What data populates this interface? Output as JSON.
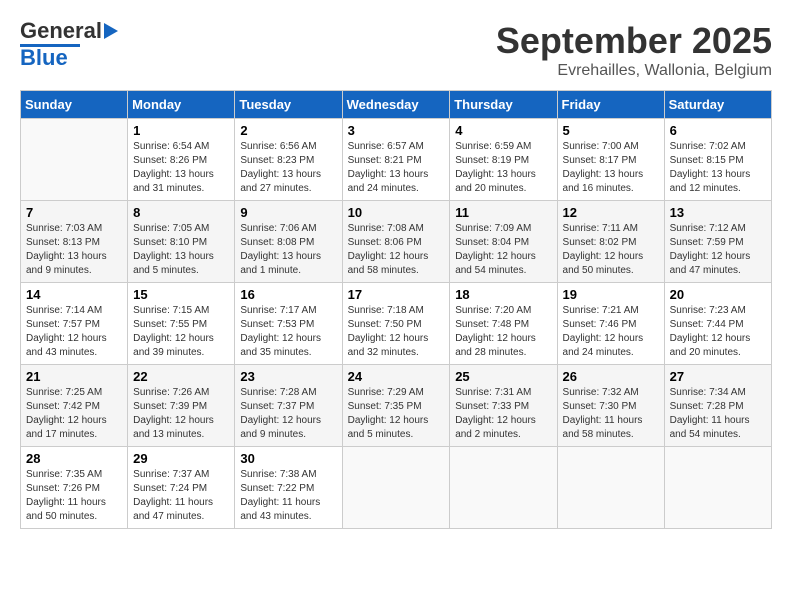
{
  "header": {
    "logo_top": "General",
    "logo_bottom": "Blue",
    "month": "September 2025",
    "location": "Evrehailles, Wallonia, Belgium"
  },
  "columns": [
    "Sunday",
    "Monday",
    "Tuesday",
    "Wednesday",
    "Thursday",
    "Friday",
    "Saturday"
  ],
  "weeks": [
    [
      {
        "day": "",
        "info": ""
      },
      {
        "day": "1",
        "info": "Sunrise: 6:54 AM\nSunset: 8:26 PM\nDaylight: 13 hours\nand 31 minutes."
      },
      {
        "day": "2",
        "info": "Sunrise: 6:56 AM\nSunset: 8:23 PM\nDaylight: 13 hours\nand 27 minutes."
      },
      {
        "day": "3",
        "info": "Sunrise: 6:57 AM\nSunset: 8:21 PM\nDaylight: 13 hours\nand 24 minutes."
      },
      {
        "day": "4",
        "info": "Sunrise: 6:59 AM\nSunset: 8:19 PM\nDaylight: 13 hours\nand 20 minutes."
      },
      {
        "day": "5",
        "info": "Sunrise: 7:00 AM\nSunset: 8:17 PM\nDaylight: 13 hours\nand 16 minutes."
      },
      {
        "day": "6",
        "info": "Sunrise: 7:02 AM\nSunset: 8:15 PM\nDaylight: 13 hours\nand 12 minutes."
      }
    ],
    [
      {
        "day": "7",
        "info": "Sunrise: 7:03 AM\nSunset: 8:13 PM\nDaylight: 13 hours\nand 9 minutes."
      },
      {
        "day": "8",
        "info": "Sunrise: 7:05 AM\nSunset: 8:10 PM\nDaylight: 13 hours\nand 5 minutes."
      },
      {
        "day": "9",
        "info": "Sunrise: 7:06 AM\nSunset: 8:08 PM\nDaylight: 13 hours\nand 1 minute."
      },
      {
        "day": "10",
        "info": "Sunrise: 7:08 AM\nSunset: 8:06 PM\nDaylight: 12 hours\nand 58 minutes."
      },
      {
        "day": "11",
        "info": "Sunrise: 7:09 AM\nSunset: 8:04 PM\nDaylight: 12 hours\nand 54 minutes."
      },
      {
        "day": "12",
        "info": "Sunrise: 7:11 AM\nSunset: 8:02 PM\nDaylight: 12 hours\nand 50 minutes."
      },
      {
        "day": "13",
        "info": "Sunrise: 7:12 AM\nSunset: 7:59 PM\nDaylight: 12 hours\nand 47 minutes."
      }
    ],
    [
      {
        "day": "14",
        "info": "Sunrise: 7:14 AM\nSunset: 7:57 PM\nDaylight: 12 hours\nand 43 minutes."
      },
      {
        "day": "15",
        "info": "Sunrise: 7:15 AM\nSunset: 7:55 PM\nDaylight: 12 hours\nand 39 minutes."
      },
      {
        "day": "16",
        "info": "Sunrise: 7:17 AM\nSunset: 7:53 PM\nDaylight: 12 hours\nand 35 minutes."
      },
      {
        "day": "17",
        "info": "Sunrise: 7:18 AM\nSunset: 7:50 PM\nDaylight: 12 hours\nand 32 minutes."
      },
      {
        "day": "18",
        "info": "Sunrise: 7:20 AM\nSunset: 7:48 PM\nDaylight: 12 hours\nand 28 minutes."
      },
      {
        "day": "19",
        "info": "Sunrise: 7:21 AM\nSunset: 7:46 PM\nDaylight: 12 hours\nand 24 minutes."
      },
      {
        "day": "20",
        "info": "Sunrise: 7:23 AM\nSunset: 7:44 PM\nDaylight: 12 hours\nand 20 minutes."
      }
    ],
    [
      {
        "day": "21",
        "info": "Sunrise: 7:25 AM\nSunset: 7:42 PM\nDaylight: 12 hours\nand 17 minutes."
      },
      {
        "day": "22",
        "info": "Sunrise: 7:26 AM\nSunset: 7:39 PM\nDaylight: 12 hours\nand 13 minutes."
      },
      {
        "day": "23",
        "info": "Sunrise: 7:28 AM\nSunset: 7:37 PM\nDaylight: 12 hours\nand 9 minutes."
      },
      {
        "day": "24",
        "info": "Sunrise: 7:29 AM\nSunset: 7:35 PM\nDaylight: 12 hours\nand 5 minutes."
      },
      {
        "day": "25",
        "info": "Sunrise: 7:31 AM\nSunset: 7:33 PM\nDaylight: 12 hours\nand 2 minutes."
      },
      {
        "day": "26",
        "info": "Sunrise: 7:32 AM\nSunset: 7:30 PM\nDaylight: 11 hours\nand 58 minutes."
      },
      {
        "day": "27",
        "info": "Sunrise: 7:34 AM\nSunset: 7:28 PM\nDaylight: 11 hours\nand 54 minutes."
      }
    ],
    [
      {
        "day": "28",
        "info": "Sunrise: 7:35 AM\nSunset: 7:26 PM\nDaylight: 11 hours\nand 50 minutes."
      },
      {
        "day": "29",
        "info": "Sunrise: 7:37 AM\nSunset: 7:24 PM\nDaylight: 11 hours\nand 47 minutes."
      },
      {
        "day": "30",
        "info": "Sunrise: 7:38 AM\nSunset: 7:22 PM\nDaylight: 11 hours\nand 43 minutes."
      },
      {
        "day": "",
        "info": ""
      },
      {
        "day": "",
        "info": ""
      },
      {
        "day": "",
        "info": ""
      },
      {
        "day": "",
        "info": ""
      }
    ]
  ]
}
